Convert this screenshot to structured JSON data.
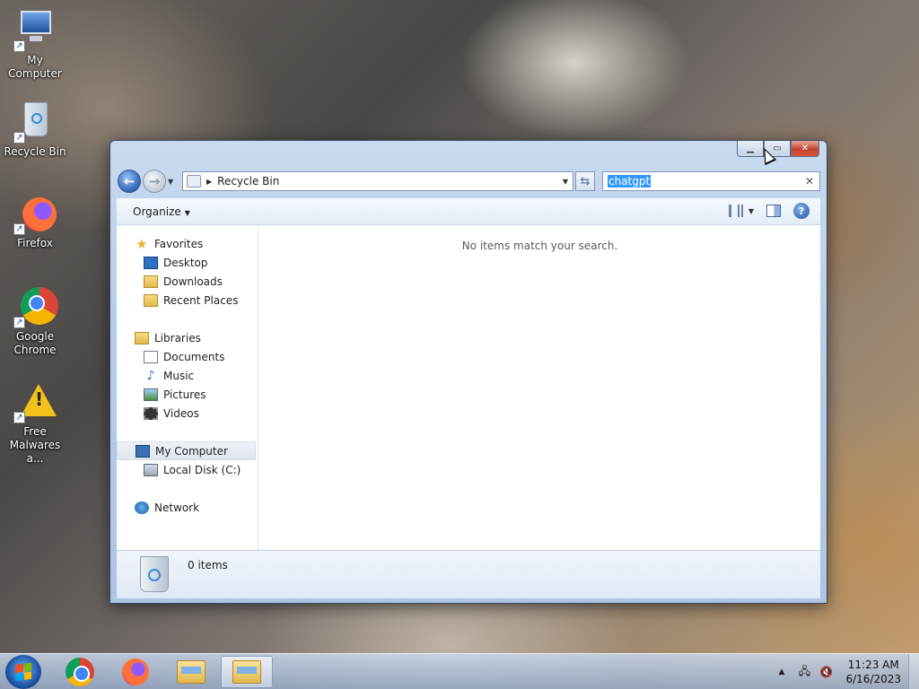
{
  "desktop": {
    "icons": [
      {
        "label": "My Computer"
      },
      {
        "label": "Recycle Bin"
      },
      {
        "label": "Firefox"
      },
      {
        "label": "Google Chrome"
      },
      {
        "label": "Free Malwares a..."
      }
    ]
  },
  "window": {
    "address": {
      "location": "Recycle Bin"
    },
    "search": {
      "value": "chatgpt"
    },
    "toolbar": {
      "organize_label": "Organize"
    },
    "navpane": {
      "favorites": {
        "label": "Favorites",
        "items": [
          "Desktop",
          "Downloads",
          "Recent Places"
        ]
      },
      "libraries": {
        "label": "Libraries",
        "items": [
          "Documents",
          "Music",
          "Pictures",
          "Videos"
        ]
      },
      "computer": {
        "label": "My Computer",
        "items": [
          "Local Disk (C:)"
        ]
      },
      "network": {
        "label": "Network"
      }
    },
    "main": {
      "empty_message": "No items match your search."
    },
    "status": {
      "items_count": "0 items"
    }
  },
  "taskbar": {
    "clock": {
      "time": "11:23 AM",
      "date": "6/16/2023"
    }
  },
  "colors": {
    "accent": "#3399ff",
    "close_button": "#c4432d"
  }
}
